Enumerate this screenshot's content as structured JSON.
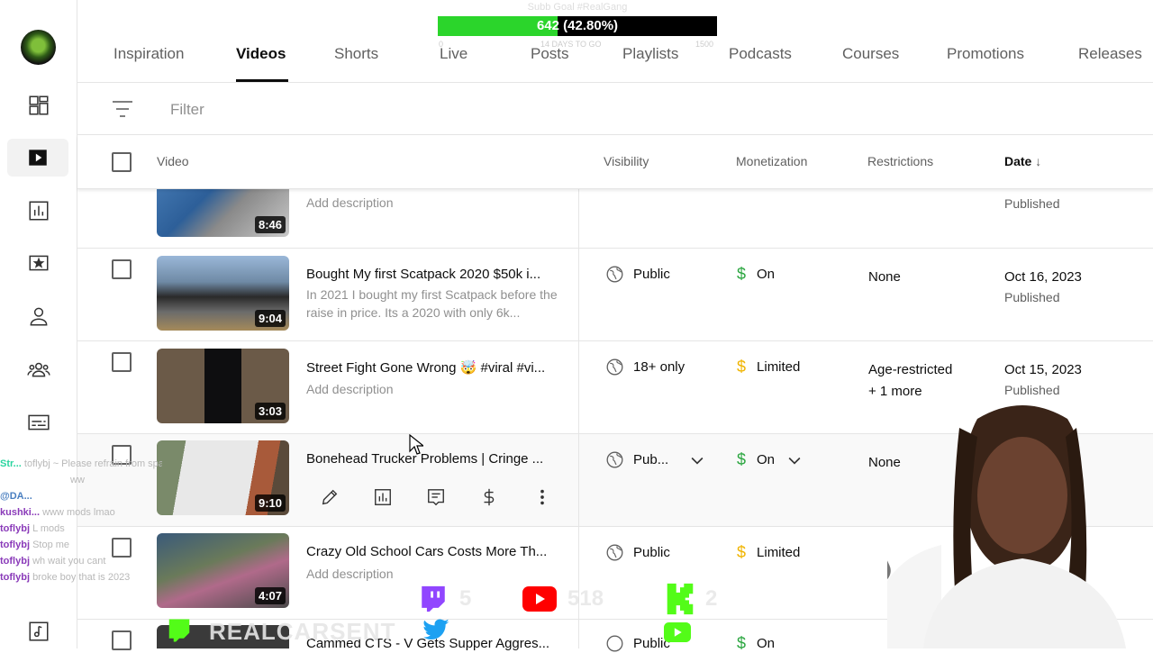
{
  "overlay": {
    "sub_goal_label": "Subb Goal #RealGang",
    "sub_progress_text": "642 (42.80%)",
    "sub_progress_fraction": 0.428,
    "sub_min": "0",
    "sub_mid": "14 DAYS TO GO",
    "sub_max": "1500"
  },
  "tabs": [
    "Inspiration",
    "Videos",
    "Shorts",
    "Live",
    "Posts",
    "Playlists",
    "Podcasts",
    "Courses",
    "Promotions",
    "Releases"
  ],
  "filter": {
    "placeholder": "Filter"
  },
  "columns": {
    "video": "Video",
    "visibility": "Visibility",
    "monetization": "Monetization",
    "restrictions": "Restrictions",
    "date": "Date"
  },
  "rows": [
    {
      "title": "",
      "description": "Add description",
      "duration": "8:46",
      "visibility": "",
      "monetization": "",
      "restrictions": "",
      "date": "",
      "status": "Published"
    },
    {
      "title": "Bought My first Scatpack 2020 $50k i...",
      "description": "In 2021 I bought my first Scatpack before the raise in price. Its a 2020 with only 6k...",
      "duration": "9:04",
      "visibility": "Public",
      "monetization": "On",
      "restrictions": "None",
      "date": "Oct 16, 2023",
      "status": "Published"
    },
    {
      "title": "Street Fight Gone Wrong 🤯 #viral #vi...",
      "description": "Add description",
      "duration": "3:03",
      "visibility": "18+ only",
      "monetization": "Limited",
      "restrictions": "Age-restricted",
      "restrictions_more": "+ 1 more",
      "date": "Oct 15, 2023",
      "status": "Published"
    },
    {
      "title": "Bonehead Trucker Problems | Cringe ...",
      "description": "",
      "duration": "9:10",
      "visibility": "Pub...",
      "monetization": "On",
      "restrictions": "None",
      "date": "",
      "status": ""
    },
    {
      "title": "Crazy Old School Cars Costs More Th...",
      "description": "Add description",
      "duration": "4:07",
      "visibility": "Public",
      "monetization": "Limited",
      "restrictions": "",
      "date": "",
      "status": ""
    },
    {
      "title": "Cammed CTS - V Gets Supper Aggres...",
      "description": "",
      "duration": "",
      "visibility": "Public",
      "monetization": "On",
      "restrictions": "",
      "date": "",
      "status": ""
    }
  ],
  "chat": [
    {
      "name": "Str...",
      "msg": "toflybj ~ Please refrain from spamming caps"
    },
    {
      "name": "",
      "msg": "ww"
    },
    {
      "name": "@DA...",
      "msg": ""
    },
    {
      "name": "kushki...",
      "msg": "www mods lmao"
    },
    {
      "name": "toflybj",
      "msg": "L mods"
    },
    {
      "name": "toflybj",
      "msg": "Stop me"
    },
    {
      "name": "toflybj",
      "msg": "wh wait you cant"
    },
    {
      "name": "toflybj",
      "msg": "broke boy that is 2023"
    }
  ],
  "stream": {
    "twitch_count": "5",
    "youtube_count": "518",
    "kick_count": "2",
    "banner": "REALCARSENT"
  }
}
